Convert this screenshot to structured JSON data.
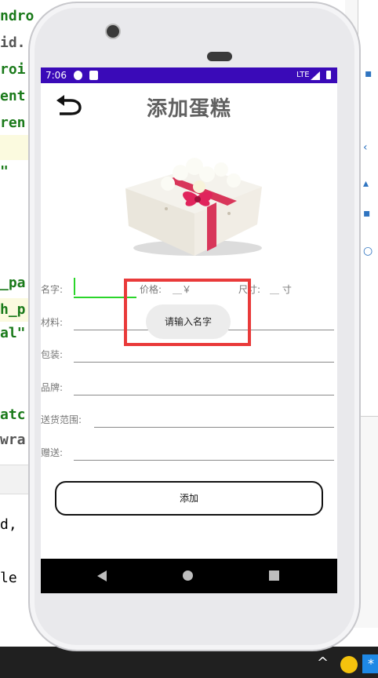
{
  "ide": {
    "code_lines": [
      "ndro",
      "id.",
      "roi",
      "ent",
      "ren",
      "\"",
      "_pa",
      "h_p",
      "al\"",
      "atc",
      "wra",
      "d,",
      "le"
    ]
  },
  "status_bar": {
    "time": "7:06",
    "network": "LTE",
    "background_color": "#3a0ab8"
  },
  "app": {
    "title": "添加蛋糕",
    "back_icon": "back-arrow-icon",
    "image": "cake-image",
    "fields": {
      "name_label": "名字:",
      "price_label": "价格:",
      "price_value": "＿￥",
      "size_label": "尺寸:",
      "size_value": "＿ 寸",
      "material_label": "材料:",
      "packaging_label": "包装:",
      "brand_label": "品牌:",
      "delivery_label": "送货范围:",
      "gift_label": "赠送:"
    },
    "add_button": "添加",
    "toast": "请输入名字"
  },
  "colors": {
    "accent_focus": "#2ad52a",
    "highlight": "#e93a3a"
  }
}
